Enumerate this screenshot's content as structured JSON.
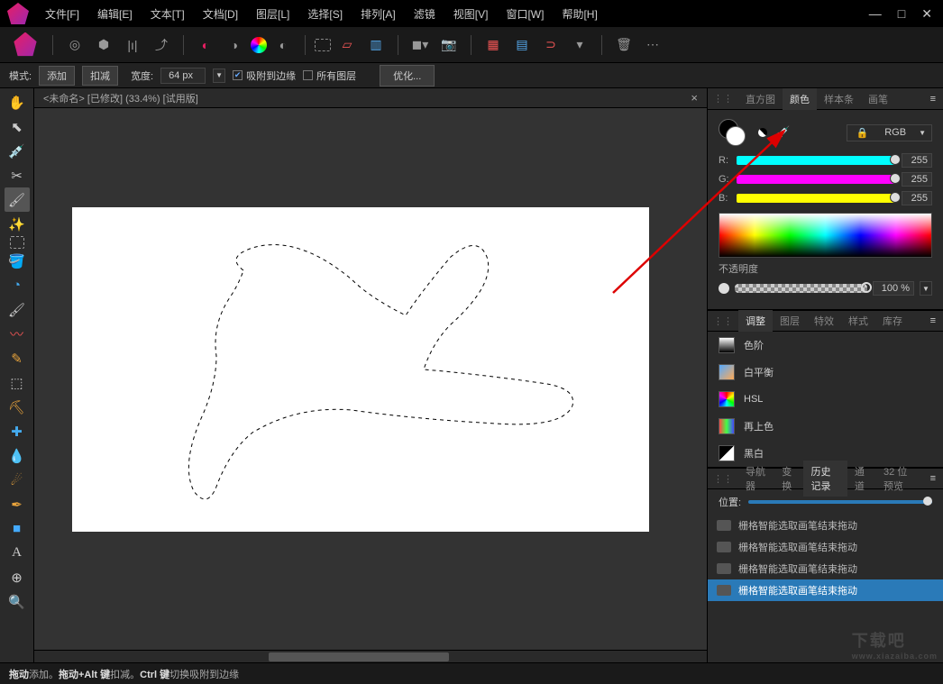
{
  "menu": {
    "file": "文件[F]",
    "edit": "编辑[E]",
    "text": "文本[T]",
    "document": "文档[D]",
    "layer": "图层[L]",
    "select": "选择[S]",
    "arrange": "排列[A]",
    "filter": "滤镜",
    "view": "视图[V]",
    "window": "窗口[W]",
    "help": "帮助[H]"
  },
  "options": {
    "mode_label": "模式:",
    "add": "添加",
    "sub": "扣减",
    "width_label": "宽度:",
    "width_val": "64 px",
    "snap": "吸附到边缘",
    "all_layers": "所有图层",
    "optimize": "优化..."
  },
  "doc": {
    "title": "<未命名> [已修改] (33.4%) [试用版]"
  },
  "color_panel": {
    "tabs": {
      "hist": "直方图",
      "color": "颜色",
      "swatches": "样本条",
      "brush": "画笔"
    },
    "mode": "RGB",
    "r": {
      "label": "R:",
      "val": "255"
    },
    "g": {
      "label": "G:",
      "val": "255"
    },
    "b": {
      "label": "B:",
      "val": "255"
    },
    "opacity_label": "不透明度",
    "opacity_val": "100 %"
  },
  "adjust_panel": {
    "tabs": {
      "adjust": "调整",
      "layers": "图层",
      "fx": "特效",
      "styles": "样式",
      "stock": "库存"
    },
    "items": [
      "色阶",
      "白平衡",
      "HSL",
      "再上色",
      "黑白"
    ]
  },
  "history_panel": {
    "tabs": {
      "nav": "导航器",
      "transform": "变换",
      "history": "历史记录",
      "channels": "通道",
      "preview": "32 位预览"
    },
    "pos_label": "位置:",
    "items": [
      "栅格智能选取画笔结束拖动",
      "栅格智能选取画笔结束拖动",
      "栅格智能选取画笔结束拖动",
      "栅格智能选取画笔结束拖动"
    ]
  },
  "status": {
    "drag": "拖动",
    "add": " 添加。",
    "dragalt": "拖动+Alt 键",
    "sub": " 扣减。",
    "ctrl": "Ctrl 键",
    "toggle": " 切换吸附到边缘"
  },
  "watermark": {
    "big": "下载吧",
    "small": "www.xiazaiba.com"
  }
}
